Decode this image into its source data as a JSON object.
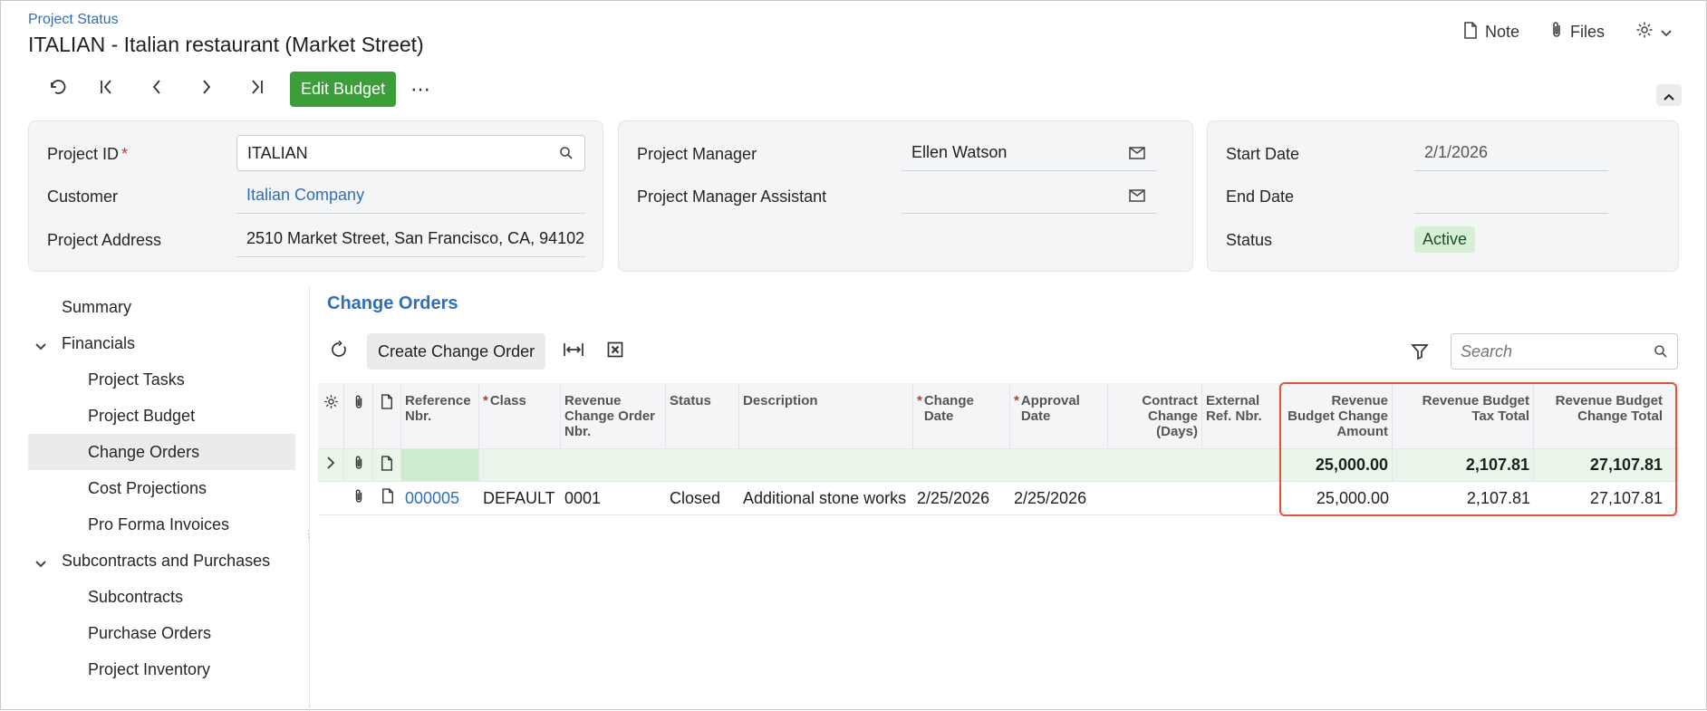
{
  "header": {
    "breadcrumb": "Project Status",
    "title": "ITALIAN - Italian restaurant (Market Street)",
    "note_label": "Note",
    "files_label": "Files"
  },
  "toolbar": {
    "edit_budget_label": "Edit Budget",
    "more_label": "⋯"
  },
  "summary": {
    "project_id_label": "Project ID",
    "project_id_value": "ITALIAN",
    "customer_label": "Customer",
    "customer_value": "Italian Company",
    "address_label": "Project Address",
    "address_value": "2510 Market Street, San Francisco, CA, 94102",
    "pm_label": "Project Manager",
    "pm_value": "Ellen Watson",
    "pma_label": "Project Manager Assistant",
    "pma_value": "",
    "start_label": "Start Date",
    "start_value": "2/1/2026",
    "end_label": "End Date",
    "end_value": "",
    "status_label": "Status",
    "status_value": "Active"
  },
  "sidebar": {
    "items": [
      {
        "label": "Summary"
      },
      {
        "label": "Financials"
      },
      {
        "label": "Project Tasks"
      },
      {
        "label": "Project Budget"
      },
      {
        "label": "Change Orders"
      },
      {
        "label": "Cost Projections"
      },
      {
        "label": "Pro Forma Invoices"
      },
      {
        "label": "Subcontracts and Purchases"
      },
      {
        "label": "Subcontracts"
      },
      {
        "label": "Purchase Orders"
      },
      {
        "label": "Project Inventory"
      }
    ]
  },
  "section": {
    "title": "Change Orders",
    "create_label": "Create Change Order",
    "search_placeholder": "Search"
  },
  "grid": {
    "columns": {
      "ref": "Reference Nbr.",
      "class": "Class",
      "rev_co": "Revenue Change Order Nbr.",
      "status": "Status",
      "desc": "Description",
      "change_date": "Change Date",
      "approval_date": "Approval Date",
      "contract_change": "Contract Change (Days)",
      "ext_ref": "External Ref. Nbr.",
      "rev_amount": "Revenue Budget Change Amount",
      "rev_tax": "Revenue Budget Tax Total",
      "rev_total": "Revenue Budget Change Total"
    },
    "summary_row": {
      "rev_amount": "25,000.00",
      "rev_tax": "2,107.81",
      "rev_total": "27,107.81"
    },
    "rows": [
      {
        "ref": "000005",
        "class": "DEFAULT",
        "rev_co": "0001",
        "status": "Closed",
        "desc": "Additional stone works",
        "change_date": "2/25/2026",
        "approval_date": "2/25/2026",
        "contract_change": "",
        "ext_ref": "",
        "rev_amount": "25,000.00",
        "rev_tax": "2,107.81",
        "rev_total": "27,107.81"
      }
    ]
  }
}
